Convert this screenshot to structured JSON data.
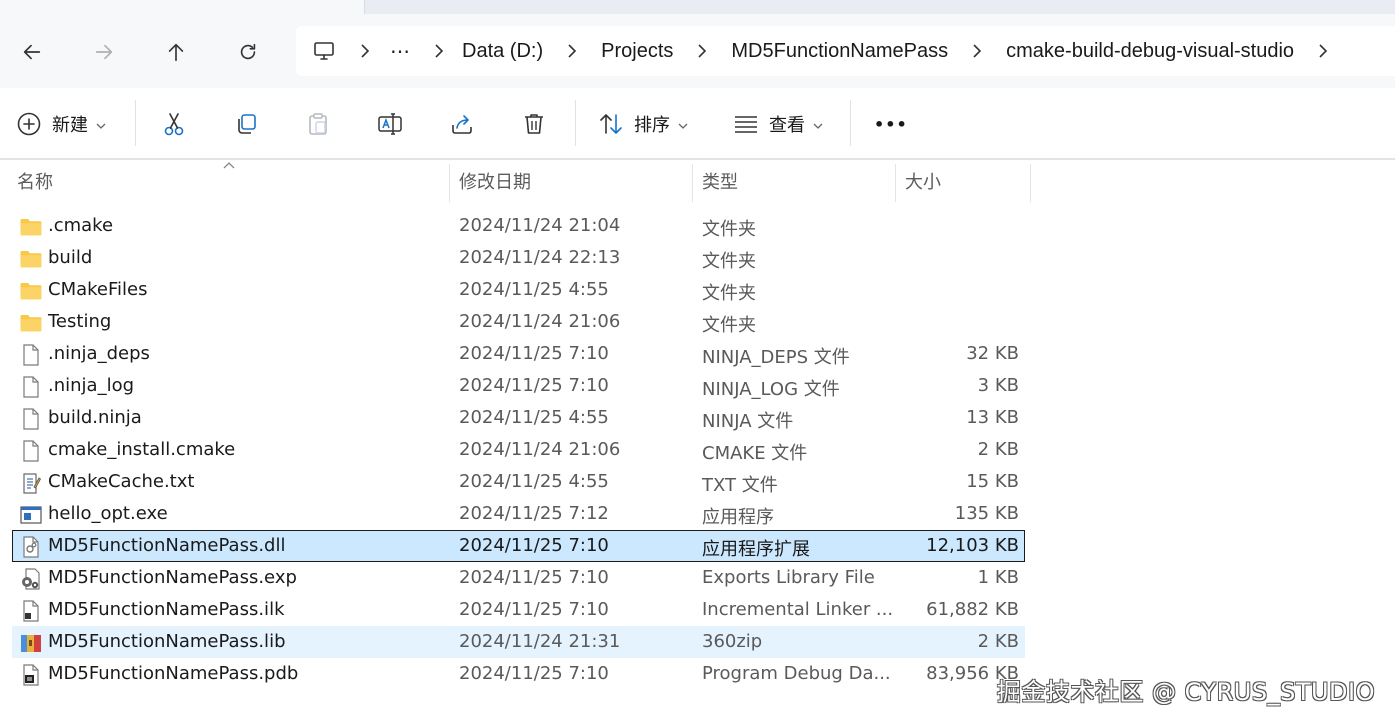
{
  "address": {
    "crumbs": [
      "Data (D:)",
      "Projects",
      "MD5FunctionNamePass",
      "cmake-build-debug-visual-studio"
    ],
    "overflow_label": "⋯"
  },
  "commands": {
    "new_label": "新建",
    "sort_label": "排序",
    "view_label": "查看",
    "more_label": "•••"
  },
  "columns": {
    "name": "名称",
    "date": "修改日期",
    "type": "类型",
    "size": "大小"
  },
  "files": [
    {
      "name": ".cmake",
      "date": "2024/11/24 21:04",
      "type": "文件夹",
      "size": "",
      "icon": "folder-icon",
      "state": ""
    },
    {
      "name": "build",
      "date": "2024/11/24 22:13",
      "type": "文件夹",
      "size": "",
      "icon": "folder-icon",
      "state": ""
    },
    {
      "name": "CMakeFiles",
      "date": "2024/11/25 4:55",
      "type": "文件夹",
      "size": "",
      "icon": "folder-icon",
      "state": ""
    },
    {
      "name": "Testing",
      "date": "2024/11/24 21:06",
      "type": "文件夹",
      "size": "",
      "icon": "folder-icon",
      "state": ""
    },
    {
      "name": ".ninja_deps",
      "date": "2024/11/25 7:10",
      "type": "NINJA_DEPS 文件",
      "size": "32 KB",
      "icon": "file-icon",
      "state": ""
    },
    {
      "name": ".ninja_log",
      "date": "2024/11/25 7:10",
      "type": "NINJA_LOG 文件",
      "size": "3 KB",
      "icon": "file-icon",
      "state": ""
    },
    {
      "name": "build.ninja",
      "date": "2024/11/25 4:55",
      "type": "NINJA 文件",
      "size": "13 KB",
      "icon": "file-icon",
      "state": ""
    },
    {
      "name": "cmake_install.cmake",
      "date": "2024/11/24 21:06",
      "type": "CMAKE 文件",
      "size": "2 KB",
      "icon": "file-icon",
      "state": ""
    },
    {
      "name": "CMakeCache.txt",
      "date": "2024/11/25 4:55",
      "type": "TXT 文件",
      "size": "15 KB",
      "icon": "text-file-icon",
      "state": ""
    },
    {
      "name": "hello_opt.exe",
      "date": "2024/11/25 7:12",
      "type": "应用程序",
      "size": "135 KB",
      "icon": "exe-icon",
      "state": ""
    },
    {
      "name": "MD5FunctionNamePass.dll",
      "date": "2024/11/25 7:10",
      "type": "应用程序扩展",
      "size": "12,103 KB",
      "icon": "dll-icon",
      "state": "selected"
    },
    {
      "name": "MD5FunctionNamePass.exp",
      "date": "2024/11/25 7:10",
      "type": "Exports Library File",
      "size": "1 KB",
      "icon": "gears-file-icon",
      "state": ""
    },
    {
      "name": "MD5FunctionNamePass.ilk",
      "date": "2024/11/25 7:10",
      "type": "Incremental Linker ...",
      "size": "61,882 KB",
      "icon": "linker-file-icon",
      "state": ""
    },
    {
      "name": "MD5FunctionNamePass.lib",
      "date": "2024/11/24 21:31",
      "type": "360zip",
      "size": "2 KB",
      "icon": "archive-icon",
      "state": "hover"
    },
    {
      "name": "MD5FunctionNamePass.pdb",
      "date": "2024/11/25 7:10",
      "type": "Program Debug Da...",
      "size": "83,956 KB",
      "icon": "pdb-file-icon",
      "state": ""
    }
  ],
  "watermark": "掘金技术社区 @ CYRUS_STUDIO",
  "colors": {
    "selected_bg": "#cce8ff",
    "hover_bg": "#e5f3ff",
    "folder": "#f8c944",
    "accent": "#1a73c7"
  }
}
